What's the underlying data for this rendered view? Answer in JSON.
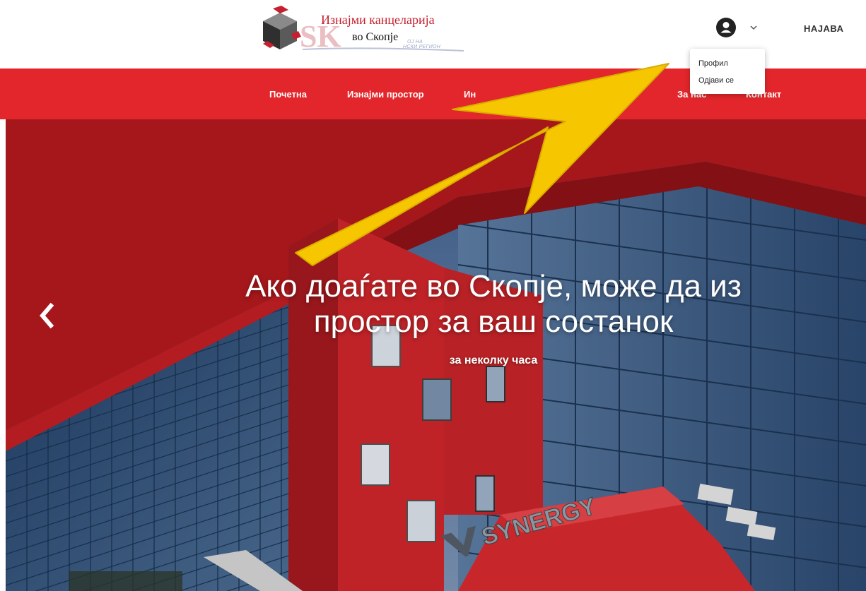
{
  "header": {
    "logo": {
      "title": "Изнајми канцеларија",
      "subtitle": "во Скопје",
      "tagline_line1": "ОЈ НА",
      "tagline_line2": "НСКИ РЕГИОН"
    },
    "login_label": "НАЈАВА"
  },
  "user_dropdown": {
    "items": [
      {
        "label": "Профил"
      },
      {
        "label": "Одјави се"
      }
    ]
  },
  "nav": {
    "items": [
      {
        "label": "Почетна"
      },
      {
        "label": "Изнајми простор"
      },
      {
        "label": "Ин"
      },
      {
        "label": "За нас"
      },
      {
        "label": "Контакт"
      }
    ]
  },
  "hero": {
    "title_line1": "Ако доаѓате во Скопје, може да из",
    "title_line2": "простор за ваш состанок",
    "subtitle": "за неколку часа",
    "building_sign": "SYNERGY"
  },
  "colors": {
    "brand_red": "#e3262b",
    "annotation_yellow": "#f6c700"
  },
  "icons": {
    "avatar": "user-avatar-icon",
    "chevron": "chevron-down-icon",
    "prev": "chevron-left-icon"
  }
}
